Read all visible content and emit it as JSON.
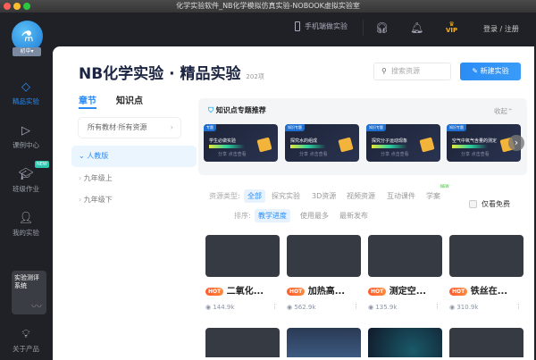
{
  "window": {
    "title": "化学实验软件_NB化学模拟仿真实验-NOBOOK虚拟实验室"
  },
  "topbar": {
    "mobile": "手机端做实验",
    "vip": "VIP",
    "login": "登录 / 注册"
  },
  "sidebar": {
    "grade": "初中▾",
    "items": [
      {
        "label": "精品实验"
      },
      {
        "label": "课例中心"
      },
      {
        "label": "班级作业",
        "badge": "NEW"
      },
      {
        "label": "我的实验"
      }
    ],
    "eval": "实验测评系统",
    "about": "关于产品"
  },
  "header": {
    "title": "NB化学实验 · 精品实验",
    "count": "202项",
    "search_placeholder": "搜索资源",
    "new_button": "新建实验"
  },
  "tabs": [
    {
      "label": "章节"
    },
    {
      "label": "知识点"
    }
  ],
  "filter": "所有教材·所有资源",
  "tree": [
    {
      "label": "人教版"
    },
    {
      "label": "九年级上"
    },
    {
      "label": "九年级下"
    }
  ],
  "recommend": {
    "title": "知识点专题推荐",
    "collapse": "收起",
    "cards": [
      {
        "tag": "专题",
        "title": "学生必做实验",
        "actions": "分享  点击查看"
      },
      {
        "tag": "知识专题",
        "title": "探究水的组成",
        "actions": "分享  点击查看"
      },
      {
        "tag": "知识专题",
        "title": "探究分子运动现象",
        "actions": "分享  点击查看"
      },
      {
        "tag": "知识专题",
        "title": "空气中氧气含量的测定",
        "actions": "分享  点击查看"
      }
    ]
  },
  "resource_types": {
    "label": "资源类型:",
    "items": [
      "全部",
      "探究实验",
      "3D资源",
      "视频资源",
      "互动课件",
      "学案"
    ],
    "new_badge": "NEW"
  },
  "sort": {
    "label": "排序:",
    "items": [
      "教学进度",
      "使用最多",
      "最新发布"
    ]
  },
  "free_only": "仅看免费",
  "experiments": [
    {
      "hot": "HOT",
      "name": "二氧化...",
      "views": "144.9k"
    },
    {
      "hot": "HOT",
      "name": "加热高...",
      "views": "562.9k"
    },
    {
      "hot": "HOT",
      "name": "测定空...",
      "views": "135.9k"
    },
    {
      "hot": "HOT",
      "name": "铁丝在...",
      "views": "310.9k"
    }
  ],
  "colors": {
    "accent": "#2b8cf5",
    "hot": "#ff6a2c",
    "dark": "#1f2126"
  }
}
